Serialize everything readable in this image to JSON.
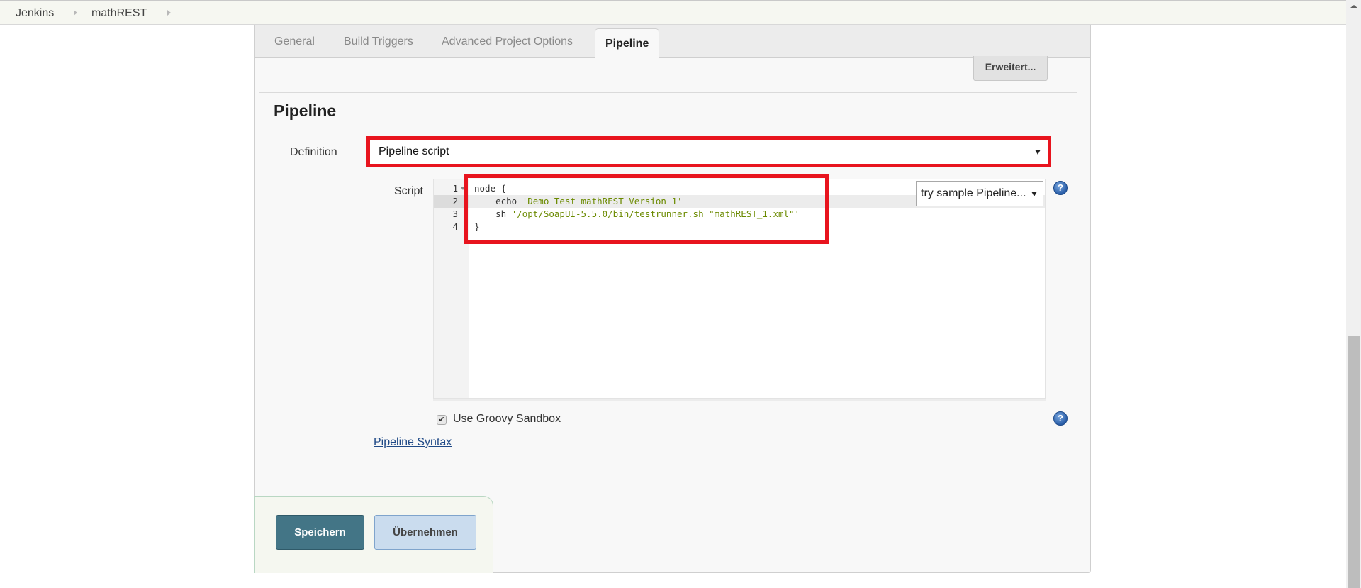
{
  "breadcrumb": {
    "items": [
      "Jenkins",
      "mathREST"
    ]
  },
  "tabs": [
    {
      "label": "General",
      "active": false
    },
    {
      "label": "Build Triggers",
      "active": false
    },
    {
      "label": "Advanced Project Options",
      "active": false
    },
    {
      "label": "Pipeline",
      "active": true
    }
  ],
  "advanced_button": "Erweitert...",
  "section": {
    "title": "Pipeline",
    "definition_label": "Definition",
    "definition_value": "Pipeline script",
    "script_label": "Script",
    "script_lines": [
      {
        "num": "1",
        "text": "node {"
      },
      {
        "num": "2",
        "keyword": "    echo ",
        "string": "'Demo Test mathREST Version 1'"
      },
      {
        "num": "3",
        "keyword": "    sh ",
        "string": "'/opt/SoapUI-5.5.0/bin/testrunner.sh \"mathREST_1.xml\"'"
      },
      {
        "num": "4",
        "text": "}"
      }
    ],
    "active_line": 2,
    "sample_select": "try sample Pipeline...",
    "sandbox_label": "Use Groovy Sandbox",
    "sandbox_checked": true,
    "syntax_link": "Pipeline Syntax",
    "help_icon_glyph": "?"
  },
  "buttons": {
    "save": "Speichern",
    "apply": "Übernehmen"
  },
  "colors": {
    "highlight": "#e8141e",
    "save_button": "#437586",
    "apply_button": "#cadcee",
    "string_literal": "#6b8a00",
    "link": "#204a87"
  }
}
